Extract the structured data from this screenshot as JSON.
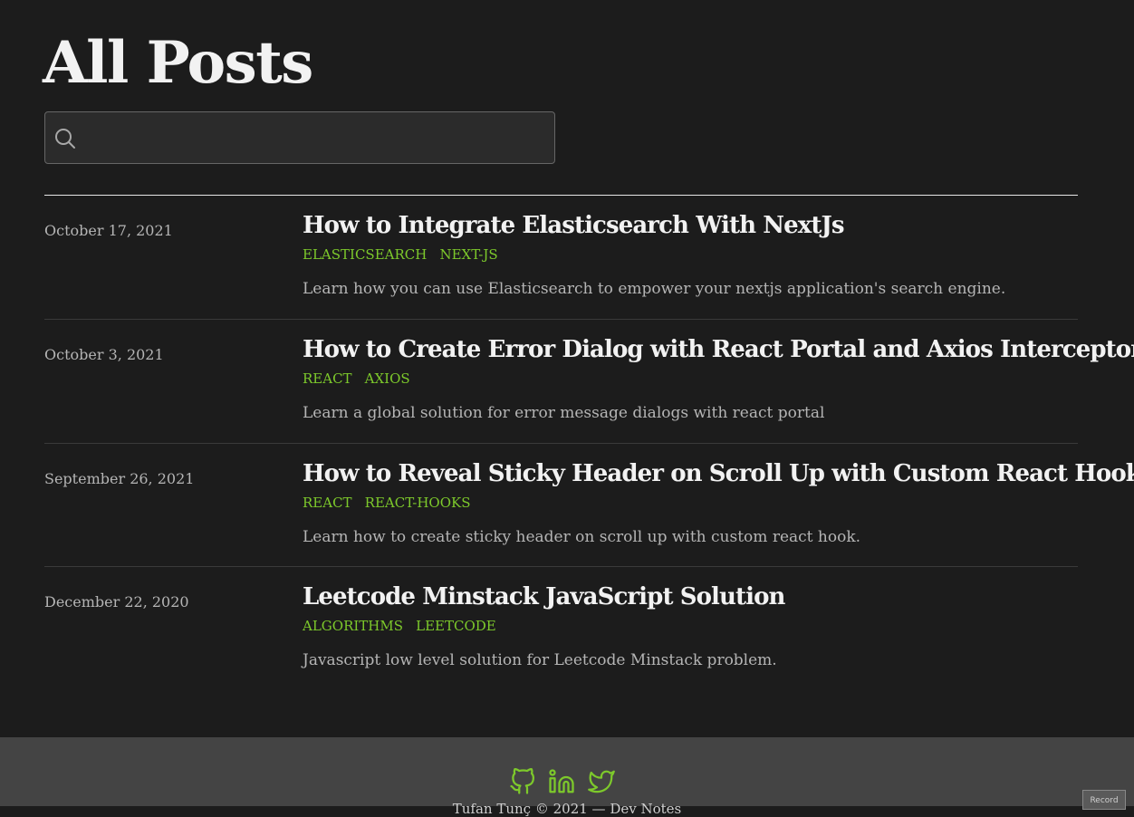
{
  "page_title": "All Posts",
  "search": {
    "value": "",
    "placeholder": ""
  },
  "posts": [
    {
      "date": "October 17, 2021",
      "title": "How to Integrate Elasticsearch With NextJs",
      "tags": [
        "ELASTICSEARCH",
        "NEXT-JS"
      ],
      "description": "Learn how you can use Elasticsearch to empower your nextjs application's search engine."
    },
    {
      "date": "October 3, 2021",
      "title": "How to Create Error Dialog with React Portal and Axios Interceptor",
      "tags": [
        "REACT",
        "AXIOS"
      ],
      "description": "Learn a global solution for error message dialogs with react portal"
    },
    {
      "date": "September 26, 2021",
      "title": "How to Reveal Sticky Header on Scroll Up with Custom React Hook",
      "tags": [
        "REACT",
        "REACT-HOOKS"
      ],
      "description": "Learn how to create sticky header on scroll up with custom react hook."
    },
    {
      "date": "December 22, 2020",
      "title": "Leetcode Minstack JavaScript Solution",
      "tags": [
        "ALGORITHMS",
        "LEETCODE"
      ],
      "description": "Javascript low level solution for Leetcode Minstack problem."
    }
  ],
  "footer": {
    "social_icons": [
      "github-icon",
      "linkedin-icon",
      "twitter-icon"
    ],
    "copyright": "Tufan Tunç © 2021 — Dev Notes"
  },
  "record_button": "Record",
  "colors": {
    "background": "#1c1c1c",
    "footer_background": "#444444",
    "accent": "#7dc92b",
    "title_text": "#f2f2f2",
    "muted_text": "#b5b5b5"
  }
}
